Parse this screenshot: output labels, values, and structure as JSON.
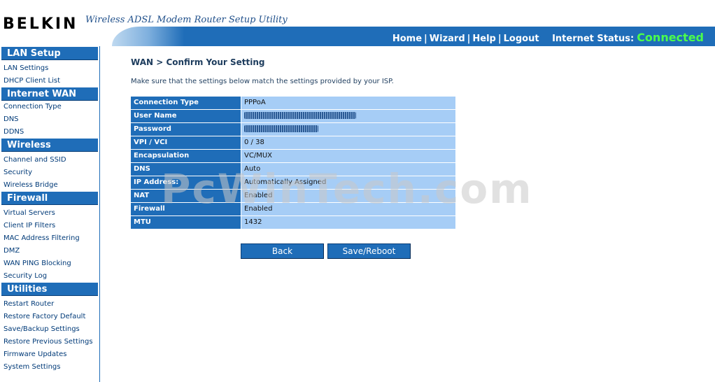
{
  "header": {
    "brand": "BELKIN",
    "subtitle": "Wireless ADSL Modem Router Setup Utility",
    "nav": {
      "home": "Home",
      "wizard": "Wizard",
      "help": "Help",
      "logout": "Logout",
      "separator": "|"
    },
    "status_label": "Internet Status:",
    "status_value": "Connected",
    "status_color": "#4bff4b",
    "accent": "#1f6db8"
  },
  "sidebar": {
    "sections": [
      {
        "title": "LAN Setup",
        "items": [
          "LAN Settings",
          "DHCP Client List"
        ]
      },
      {
        "title": "Internet WAN",
        "items": [
          "Connection Type",
          "DNS",
          "DDNS"
        ]
      },
      {
        "title": "Wireless",
        "items": [
          "Channel and SSID",
          "Security",
          "Wireless Bridge"
        ]
      },
      {
        "title": "Firewall",
        "items": [
          "Virtual Servers",
          "Client IP Filters",
          "MAC Address Filtering",
          "DMZ",
          "WAN PING Blocking",
          "Security Log"
        ]
      },
      {
        "title": "Utilities",
        "items": [
          "Restart Router",
          "Restore Factory Default",
          "Save/Backup Settings",
          "Restore Previous Settings",
          "Firmware Updates",
          "System Settings"
        ]
      }
    ]
  },
  "main": {
    "title": "WAN > Confirm Your Setting",
    "intro": "Make sure that the settings below match the settings provided by your ISP.",
    "rows": [
      {
        "label": "Connection Type",
        "value": "PPPoA"
      },
      {
        "label": "User Name",
        "value": ""
      },
      {
        "label": "Password",
        "value": ""
      },
      {
        "label": "VPI / VCI",
        "value": "0 / 38"
      },
      {
        "label": "Encapsulation",
        "value": "VC/MUX"
      },
      {
        "label": "DNS",
        "value": "Auto"
      },
      {
        "label": "IP Address:",
        "value": "Automatically Assigned"
      },
      {
        "label": "NAT",
        "value": "Enabled"
      },
      {
        "label": "Firewall",
        "value": "Enabled"
      },
      {
        "label": "MTU",
        "value": "1432"
      }
    ],
    "buttons": {
      "back": "Back",
      "save": "Save/Reboot"
    }
  },
  "watermark": "PcWinTech.com"
}
